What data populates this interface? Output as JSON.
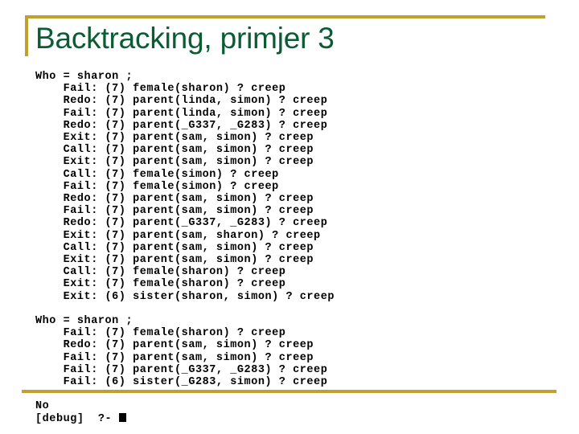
{
  "slide": {
    "title": "Backtracking, primjer 3",
    "title_color": "#0b5c34",
    "accent_color": "#bfa12c",
    "background_color": "#ffffff",
    "text_color": "#000000"
  },
  "console": {
    "lines": [
      "Who = sharon ;",
      "    Fail: (7) female(sharon) ? creep",
      "    Redo: (7) parent(linda, simon) ? creep",
      "    Fail: (7) parent(linda, simon) ? creep",
      "    Redo: (7) parent(_G337, _G283) ? creep",
      "    Exit: (7) parent(sam, simon) ? creep",
      "    Call: (7) parent(sam, simon) ? creep",
      "    Exit: (7) parent(sam, simon) ? creep",
      "    Call: (7) female(simon) ? creep",
      "    Fail: (7) female(simon) ? creep",
      "    Redo: (7) parent(sam, simon) ? creep",
      "    Fail: (7) parent(sam, simon) ? creep",
      "    Redo: (7) parent(_G337, _G283) ? creep",
      "    Exit: (7) parent(sam, sharon) ? creep",
      "    Call: (7) parent(sam, simon) ? creep",
      "    Exit: (7) parent(sam, simon) ? creep",
      "    Call: (7) female(sharon) ? creep",
      "    Exit: (7) female(sharon) ? creep",
      "    Exit: (6) sister(sharon, simon) ? creep",
      "",
      "Who = sharon ;",
      "    Fail: (7) female(sharon) ? creep",
      "    Redo: (7) parent(sam, simon) ? creep",
      "    Fail: (7) parent(sam, simon) ? creep",
      "    Fail: (7) parent(_G337, _G283) ? creep",
      "    Fail: (6) sister(_G283, simon) ? creep",
      "",
      "No"
    ],
    "prompt": "[debug]  ?- ",
    "cursor": "block-cursor"
  }
}
